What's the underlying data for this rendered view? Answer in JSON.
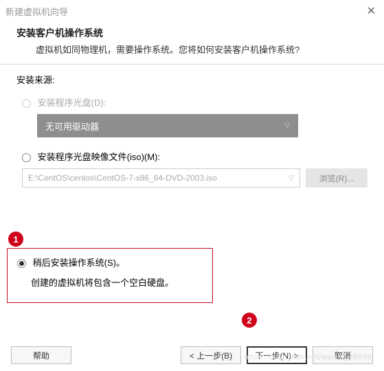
{
  "window": {
    "title": "新建虚拟机向导",
    "close_glyph": "✕"
  },
  "header": {
    "title": "安装客户机操作系统",
    "subtitle": "虚拟机如同物理机，需要操作系统。您将如何安装客户机操作系统?"
  },
  "source_label": "安装来源:",
  "option_disc": {
    "label": "安装程序光盘(D):",
    "dropdown_text": "无可用驱动器"
  },
  "option_iso": {
    "label": "安装程序光盘映像文件(iso)(M):",
    "path": "E:\\CentOS\\centos\\CentOS-7-x86_64-DVD-2003.iso",
    "browse": "浏览(R)..."
  },
  "option_later": {
    "label": "稍后安装操作系统(S)。",
    "desc": "创建的虚拟机将包含一个空白硬盘。"
  },
  "callouts": {
    "one": "1",
    "two": "2"
  },
  "buttons": {
    "help": "帮助",
    "back": "< 上一步(B)",
    "next": "下一步(N) >",
    "cancel": "取消"
  },
  "watermark": "https://blog.csdn.net/weixin_48649"
}
